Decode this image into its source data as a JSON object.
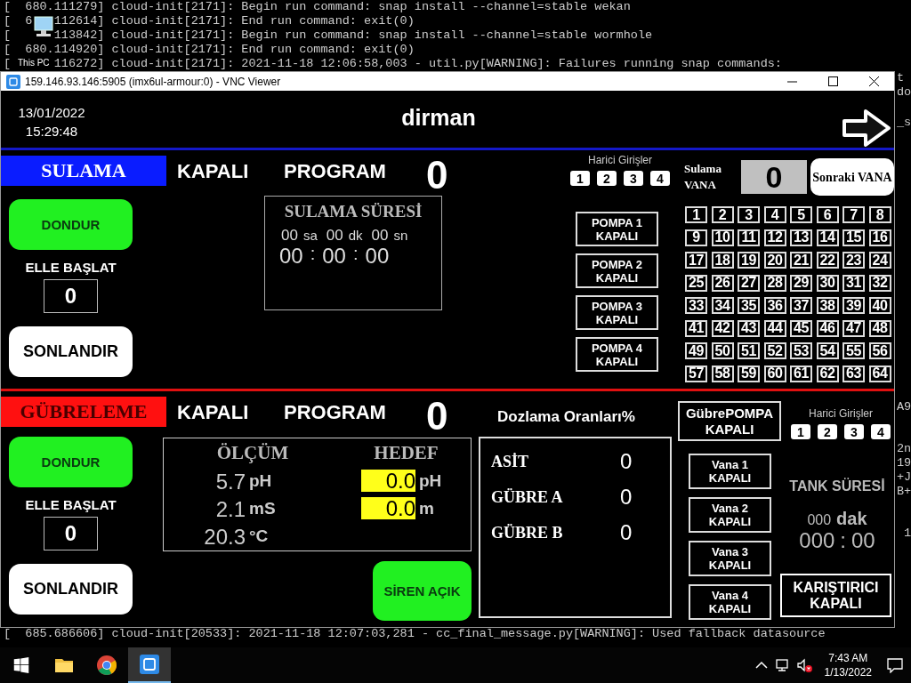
{
  "terminal": {
    "lines": [
      {
        "lead": "[  680.111279] cloud-init[2171]: Begin run command: snap install --channel=stable wekan"
      },
      {
        "lead": "[  6",
        "rest": "112614] cloud-init[2171]: End run command: exit(0)"
      },
      {
        "lead": "[  ",
        "rest": "113842] cloud-init[2171]: Begin run command: snap install --channel=stable wormhole"
      },
      {
        "lead": "[  680.114920] cloud-init[2171]: End run command: exit(0)"
      },
      {
        "lead": "[  ",
        "rest": "116272] cloud-init[2171]: 2021-11-18 12:06:58,003 - util.py[WARNING]: Failures running snap commands:"
      }
    ],
    "right_fragments": [
      "t",
      "do",
      "_s",
      "A9",
      "2n",
      "19",
      "+J",
      "B+",
      "1"
    ],
    "bottom_line": "[  685.686606] cloud-init[20533]: 2021-11-18 12:07:03,281 - cc_final_message.py[WARNING]: Used fallback datasource"
  },
  "desktop_icon": {
    "label": "This PC"
  },
  "vnc_window": {
    "title": "159.146.93.146:5905 (imx6ul-armour:0) - VNC Viewer",
    "hmi": {
      "header": {
        "date": "13/01/2022",
        "time": "15:29:48",
        "title": "dirman"
      },
      "irrigation": {
        "banner": "SULAMA",
        "status": "KAPALI",
        "program_label": "PROGRAM",
        "program_number": "0",
        "freeze_button": "DONDUR",
        "manual_start_label": "ELLE BAŞLAT",
        "manual_start_value": "0",
        "end_button": "SONLANDIR",
        "duration": {
          "title": "SULAMA SÜRESİ",
          "set": [
            {
              "value": "00",
              "unit": "sa"
            },
            {
              "value": "00",
              "unit": "dk"
            },
            {
              "value": "00",
              "unit": "sn"
            }
          ],
          "elapsed": [
            "00",
            "00",
            "00"
          ],
          "separator": ":"
        },
        "external_inputs": {
          "label": "Harici Girişler",
          "keys": [
            "1",
            "2",
            "3",
            "4"
          ]
        },
        "current_valve": {
          "label": "Sulama VANA",
          "value": "0"
        },
        "next_valve_button": "Sonraki VANA",
        "pumps": [
          {
            "name": "POMPA 1",
            "state": "KAPALI"
          },
          {
            "name": "POMPA 2",
            "state": "KAPALI"
          },
          {
            "name": "POMPA 3",
            "state": "KAPALI"
          },
          {
            "name": "POMPA 4",
            "state": "KAPALI"
          }
        ],
        "valves": [
          "1",
          "2",
          "3",
          "4",
          "5",
          "6",
          "7",
          "8",
          "9",
          "10",
          "11",
          "12",
          "13",
          "14",
          "15",
          "16",
          "17",
          "18",
          "19",
          "20",
          "21",
          "22",
          "23",
          "24",
          "25",
          "26",
          "27",
          "28",
          "29",
          "30",
          "31",
          "32",
          "33",
          "34",
          "35",
          "36",
          "37",
          "38",
          "39",
          "40",
          "41",
          "42",
          "43",
          "44",
          "45",
          "46",
          "47",
          "48",
          "49",
          "50",
          "51",
          "52",
          "53",
          "54",
          "55",
          "56",
          "57",
          "58",
          "59",
          "60",
          "61",
          "62",
          "63",
          "64"
        ]
      },
      "fertigation": {
        "banner": "GÜBRELEME",
        "status": "KAPALI",
        "program_label": "PROGRAM",
        "program_number": "0",
        "freeze_button": "DONDUR",
        "manual_start_label": "ELLE BAŞLAT",
        "manual_start_value": "0",
        "end_button": "SONLANDIR",
        "measurement": {
          "measured_title": "ÖLÇÜM",
          "target_title": "HEDEF",
          "measured": [
            {
              "value": "5.7",
              "unit": "pH"
            },
            {
              "value": "2.1",
              "unit": "mS"
            },
            {
              "value": "20.3",
              "unit": "°C"
            }
          ],
          "targets": [
            {
              "value": "0.0",
              "unit": "pH"
            },
            {
              "value": "0.0",
              "unit": "m"
            }
          ]
        },
        "siren_button": "SİREN AÇIK",
        "dosing": {
          "title": "Dozlama Oranları%",
          "rates": [
            {
              "name": "ASİT",
              "value": "0"
            },
            {
              "name": "GÜBRE A",
              "value": "0"
            },
            {
              "name": "GÜBRE B",
              "value": "0"
            }
          ]
        },
        "fertilizer_pump": {
          "name": "GübrePOMPA",
          "state": "KAPALI"
        },
        "external_inputs": {
          "label": "Harici Girişler",
          "keys": [
            "1",
            "2",
            "3",
            "4"
          ]
        },
        "tank_valves": [
          {
            "name": "Vana 1",
            "state": "KAPALI"
          },
          {
            "name": "Vana 2",
            "state": "KAPALI"
          },
          {
            "name": "Vana 3",
            "state": "KAPALI"
          },
          {
            "name": "Vana 4",
            "state": "KAPALI"
          }
        ],
        "tank_time": {
          "title": "TANK SÜRESİ",
          "set_value": "000",
          "set_unit": "dak",
          "elapsed": [
            "000",
            "00"
          ],
          "separator": ":"
        },
        "mixer": {
          "name": "KARIŞTIRICI",
          "state": "KAPALI"
        }
      }
    }
  },
  "taskbar": {
    "apps": [
      {
        "kind": "explorer",
        "selected": false
      },
      {
        "kind": "chrome",
        "selected": false
      },
      {
        "kind": "vnc",
        "selected": true
      }
    ],
    "volume": {
      "muted": true
    },
    "time": "7:43 AM",
    "date": "1/13/2022"
  }
}
